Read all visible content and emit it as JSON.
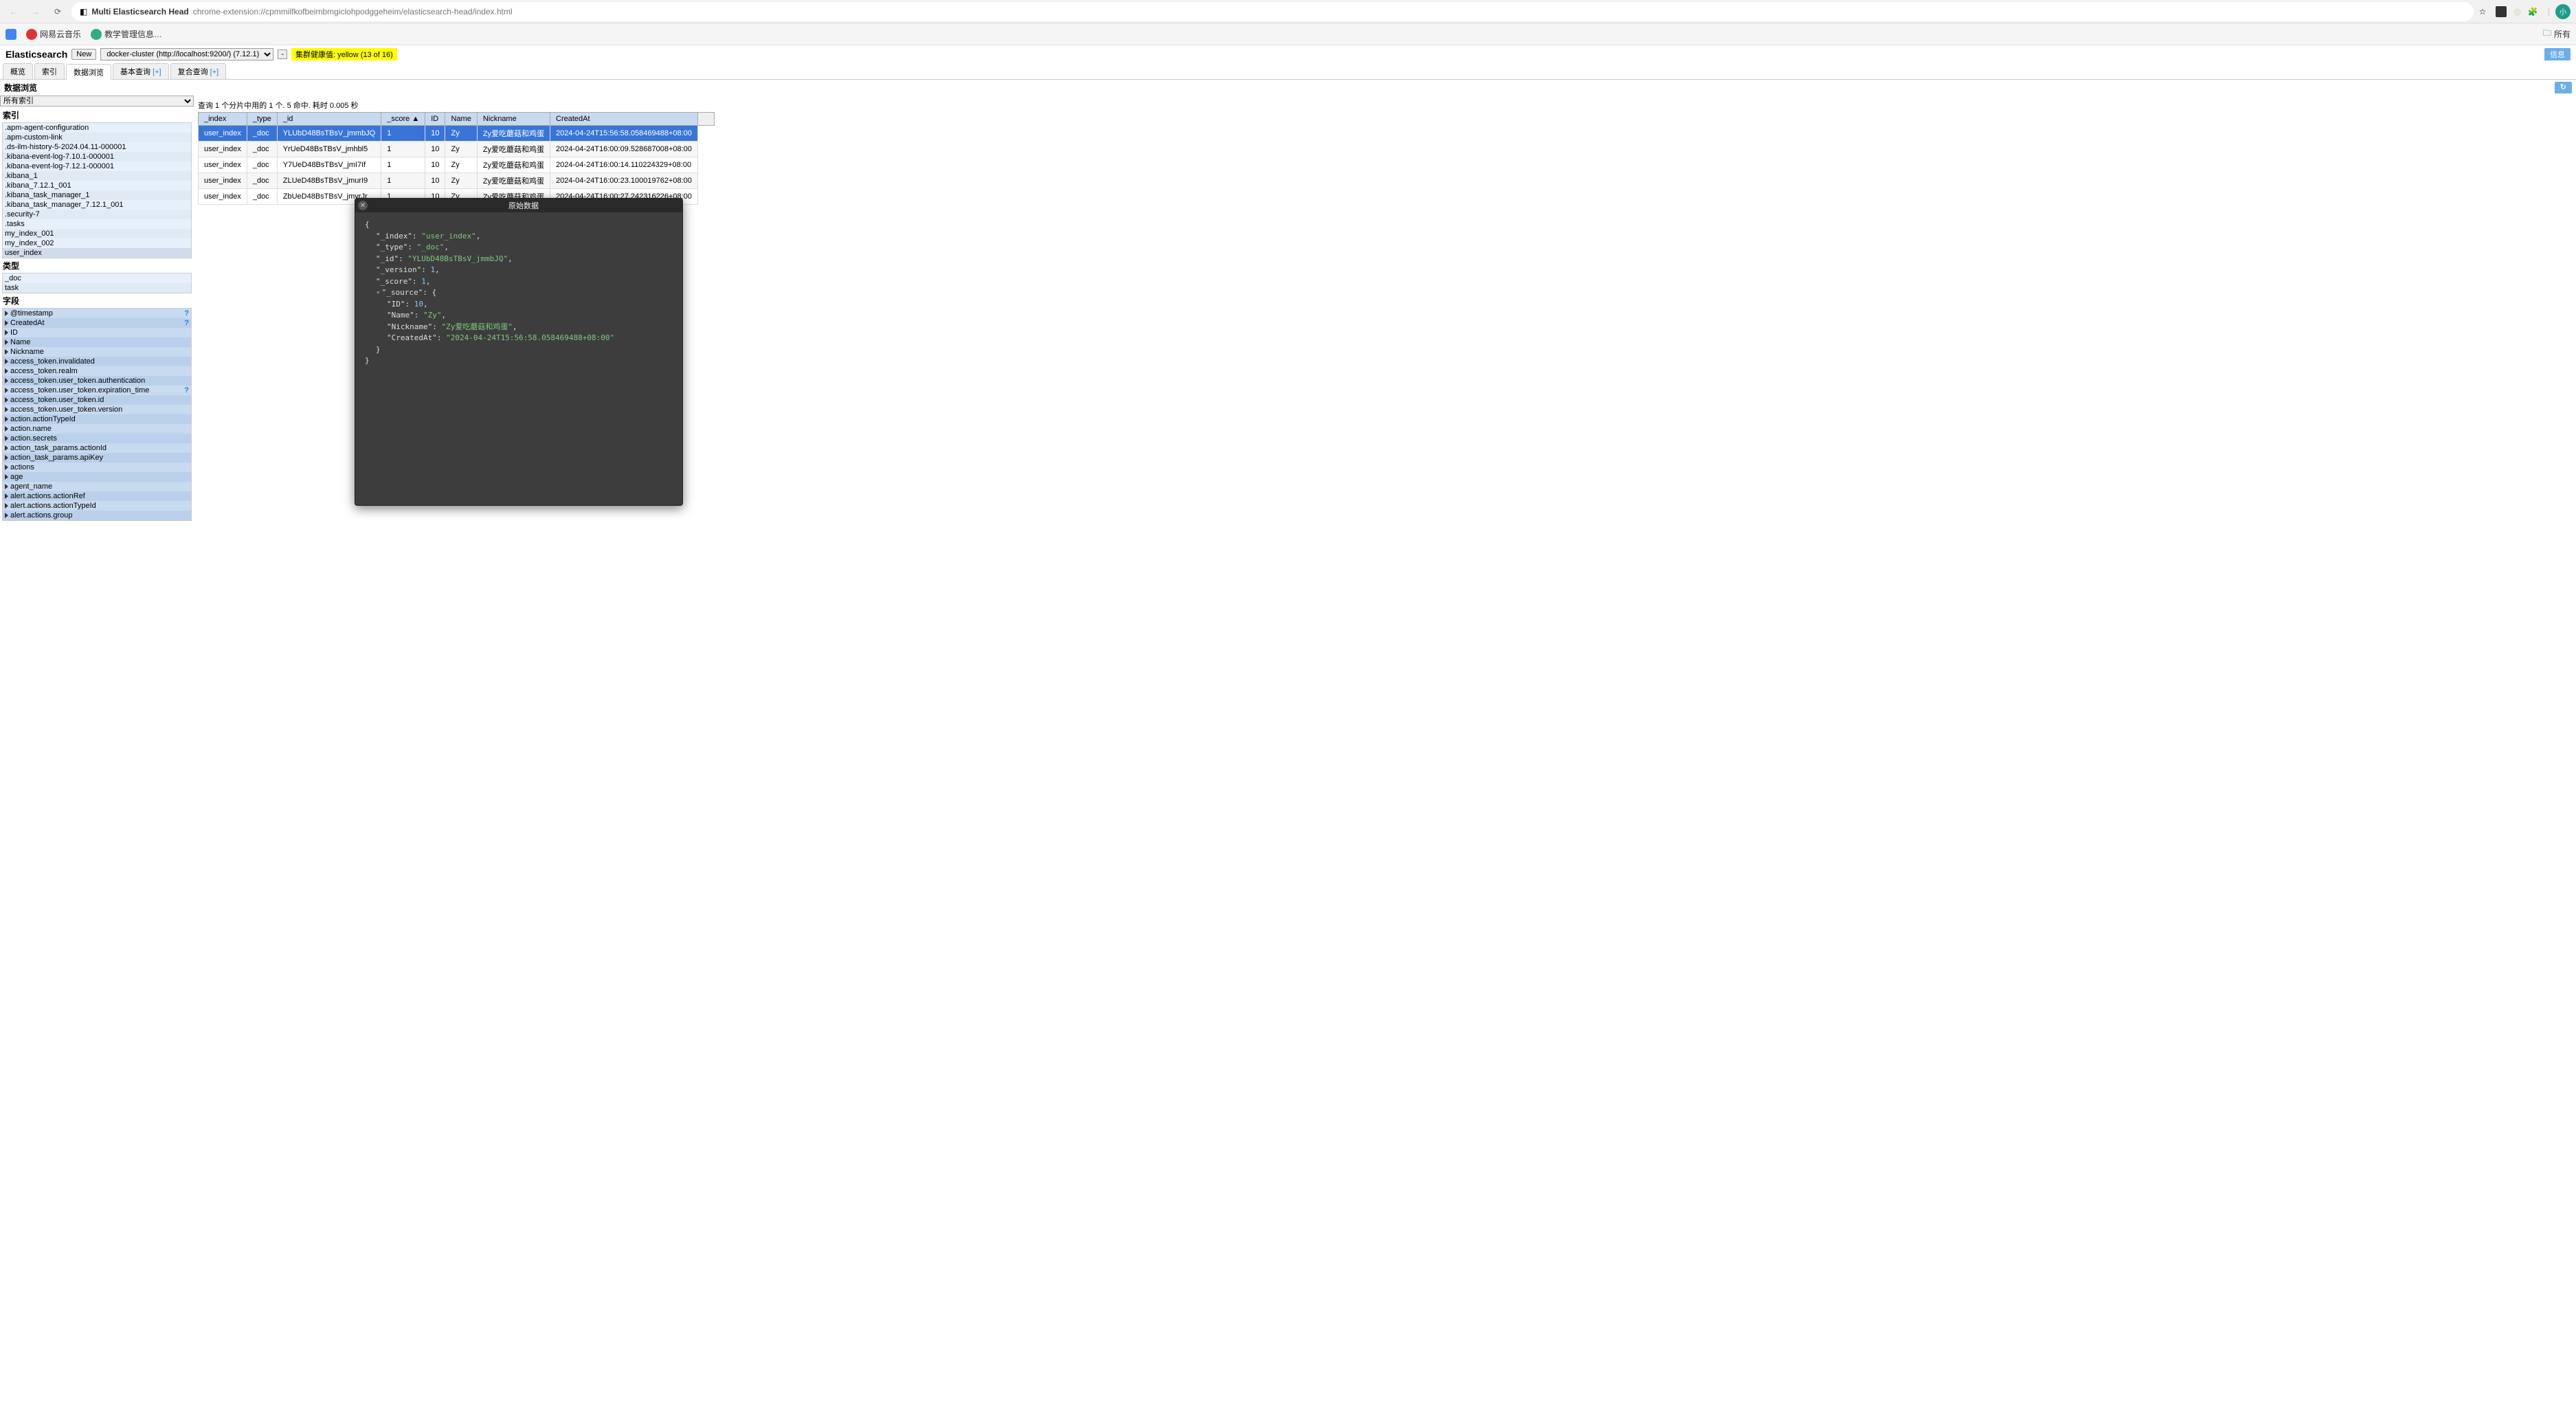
{
  "browser": {
    "title": "Multi Elasticsearch Head",
    "url": "chrome-extension://cpmmilfkofbeimbmgiclohpodggeheim/elasticsearch-head/index.html",
    "avatar_text": "小"
  },
  "bookmarks": {
    "wangyi": "网易云音乐",
    "jiaoxue": "教学管理信息…",
    "all": "所有"
  },
  "header": {
    "title": "Elasticsearch",
    "new_btn": "New",
    "cluster": "docker-cluster (http://localhost:9200/) (7.12.1)",
    "collapse": "-",
    "health": "集群健康值: yellow (13 of 16)",
    "info": "信息"
  },
  "tabs": {
    "overview": "概览",
    "indices": "索引",
    "browser": "数据浏览",
    "basic": "基本查询",
    "basic_plus": "[+]",
    "compound": "复合查询",
    "compound_plus": "[+]"
  },
  "browser_title": "数据浏览",
  "sidebar": {
    "all_indices": "所有索引",
    "indices_label": "索引",
    "types_label": "类型",
    "fields_label": "字段",
    "indices": [
      ".apm-agent-configuration",
      ".apm-custom-link",
      ".ds-ilm-history-5-2024.04.11-000001",
      ".kibana-event-log-7.10.1-000001",
      ".kibana-event-log-7.12.1-000001",
      ".kibana_1",
      ".kibana_7.12.1_001",
      ".kibana_task_manager_1",
      ".kibana_task_manager_7.12.1_001",
      ".security-7",
      ".tasks",
      "my_index_001",
      "my_index_002",
      "user_index"
    ],
    "selected_index": "user_index",
    "types": [
      "_doc",
      "task"
    ],
    "fields": [
      {
        "name": "@timestamp",
        "q": true
      },
      {
        "name": "CreatedAt",
        "q": true
      },
      {
        "name": "ID",
        "q": false
      },
      {
        "name": "Name",
        "q": false
      },
      {
        "name": "Nickname",
        "q": false
      },
      {
        "name": "access_token.invalidated",
        "q": false
      },
      {
        "name": "access_token.realm",
        "q": false
      },
      {
        "name": "access_token.user_token.authentication",
        "q": false
      },
      {
        "name": "access_token.user_token.expiration_time",
        "q": true
      },
      {
        "name": "access_token.user_token.id",
        "q": false
      },
      {
        "name": "access_token.user_token.version",
        "q": false
      },
      {
        "name": "action.actionTypeId",
        "q": false
      },
      {
        "name": "action.name",
        "q": false
      },
      {
        "name": "action.secrets",
        "q": false
      },
      {
        "name": "action_task_params.actionId",
        "q": false
      },
      {
        "name": "action_task_params.apiKey",
        "q": false
      },
      {
        "name": "actions",
        "q": false
      },
      {
        "name": "age",
        "q": false
      },
      {
        "name": "agent_name",
        "q": false
      },
      {
        "name": "alert.actions.actionRef",
        "q": false
      },
      {
        "name": "alert.actions.actionTypeId",
        "q": false
      },
      {
        "name": "alert.actions.group",
        "q": false
      }
    ]
  },
  "results": {
    "info": "查询 1 个分片中用的 1 个. 5 命中. 耗时 0.005 秒",
    "columns": [
      "_index",
      "_type",
      "_id",
      "_score",
      "ID",
      "Name",
      "Nickname",
      "CreatedAt"
    ],
    "sort_col": "_score",
    "rows": [
      {
        "_index": "user_index",
        "_type": "_doc",
        "_id": "YLUbD48BsTBsV_jmmbJQ",
        "_score": "1",
        "ID": "10",
        "Name": "Zy",
        "Nickname": "Zy爱吃蘑菇和鸡蛋",
        "CreatedAt": "2024-04-24T15:56:58.058469488+08:00",
        "selected": true
      },
      {
        "_index": "user_index",
        "_type": "_doc",
        "_id": "YrUeD48BsTBsV_jmhbl5",
        "_score": "1",
        "ID": "10",
        "Name": "Zy",
        "Nickname": "Zy爱吃蘑菇和鸡蛋",
        "CreatedAt": "2024-04-24T16:00:09.528687008+08:00"
      },
      {
        "_index": "user_index",
        "_type": "_doc",
        "_id": "Y7UeD48BsTBsV_jmI7If",
        "_score": "1",
        "ID": "10",
        "Name": "Zy",
        "Nickname": "Zy爱吃蘑菇和鸡蛋",
        "CreatedAt": "2024-04-24T16:00:14.110224329+08:00"
      },
      {
        "_index": "user_index",
        "_type": "_doc",
        "_id": "ZLUeD48BsTBsV_jmurI9",
        "_score": "1",
        "ID": "10",
        "Name": "Zy",
        "Nickname": "Zy爱吃蘑菇和鸡蛋",
        "CreatedAt": "2024-04-24T16:00:23.100019762+08:00"
      },
      {
        "_index": "user_index",
        "_type": "_doc",
        "_id": "ZbUeD48BsTBsV_jmyrJr",
        "_score": "1",
        "ID": "10",
        "Name": "Zy",
        "Nickname": "Zy爱吃蘑菇和鸡蛋",
        "CreatedAt": "2024-04-24T16:00:27.242316226+08:00"
      }
    ]
  },
  "popup": {
    "title": "原始数据",
    "json": {
      "_index": "user_index",
      "_type": "_doc",
      "_id": "YLUbD48BsTBsV_jmmbJQ",
      "_version": "1",
      "_score": "1",
      "ID": "10",
      "Name": "Zy",
      "Nickname": "Zy爱吃蘑菇和鸡蛋",
      "CreatedAt": "2024-04-24T15:56:58.058469488+08:00"
    }
  }
}
